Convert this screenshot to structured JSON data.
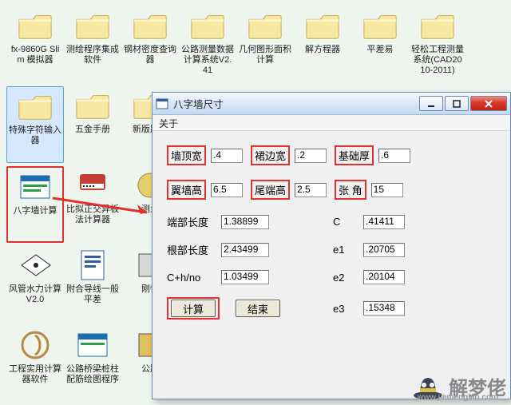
{
  "desktop": {
    "icons": [
      {
        "type": "folder",
        "label": "fx-9860G Slim 模拟器"
      },
      {
        "type": "folder",
        "label": "测绘程序集成软件"
      },
      {
        "type": "folder",
        "label": "钢材密度查询器"
      },
      {
        "type": "folder",
        "label": "公路测量数据计算系统V2.41"
      },
      {
        "type": "folder",
        "label": "几何图形面积计算"
      },
      {
        "type": "folder",
        "label": "解方程器"
      },
      {
        "type": "folder",
        "label": "平差易"
      },
      {
        "type": "folder",
        "label": "轻松工程测量系统(CAD2010-2011)"
      },
      {
        "type": "folder",
        "label": "特殊字符输入器",
        "selected": true
      },
      {
        "type": "folder",
        "label": "五金手册"
      },
      {
        "type": "folder",
        "label": "新版路图"
      },
      {
        "type": "app-window",
        "label": "八字墙计算",
        "highlight": true
      },
      {
        "type": "app-piano",
        "label": "比拟正交异板法计算器"
      },
      {
        "type": "app-generic",
        "label": "测量"
      },
      {
        "type": "app-plane",
        "label": "风管水力计算V2.0"
      },
      {
        "type": "app-doc",
        "label": "附合导线一般平差"
      },
      {
        "type": "app-generic",
        "label": "刚性"
      },
      {
        "type": "app-snail",
        "label": "工程实用计算器软件"
      },
      {
        "type": "app-window",
        "label": "公路桥梁桩柱配筋绘图程序"
      },
      {
        "type": "app-generic",
        "label": "公路"
      }
    ]
  },
  "window": {
    "title": "八字墙尺寸",
    "menu": "关于",
    "rows": {
      "r1": [
        {
          "label": "墙顶宽",
          "value": ".4"
        },
        {
          "label": "裙边宽",
          "value": ".2"
        },
        {
          "label": "基础厚",
          "value": ".6"
        }
      ],
      "r2": [
        {
          "label": "翼墙高",
          "value": "6.5"
        },
        {
          "label": "尾端高",
          "value": "2.5"
        },
        {
          "label": "张  角",
          "value": "15"
        }
      ]
    },
    "outputs": [
      {
        "left": "端部长度",
        "lval": "1.38899",
        "right": "C",
        "rval": ".41411"
      },
      {
        "left": "根部长度",
        "lval": "2.43499",
        "right": "e1",
        "rval": ".20705"
      },
      {
        "left": "C+h/no",
        "lval": "1.03499",
        "right": "e2",
        "rval": ".20104"
      }
    ],
    "last": {
      "btn_calc": "计算",
      "btn_end": "结束",
      "right": "e3",
      "rval": ".15348"
    }
  },
  "watermark": {
    "text": "解梦佬",
    "sub": "www.jiemenglao.com"
  }
}
